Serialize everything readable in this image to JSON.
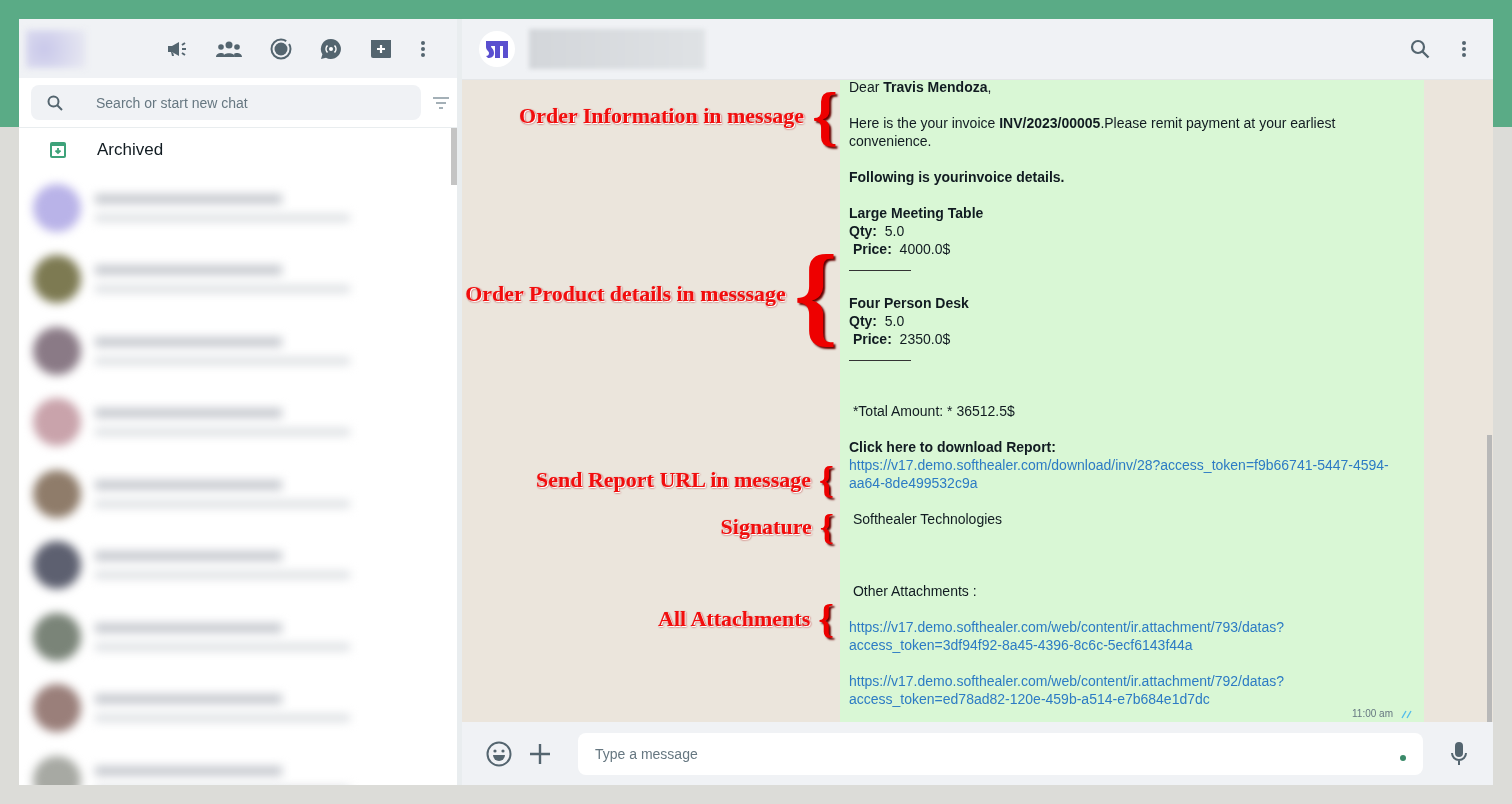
{
  "sidebar": {
    "search": {
      "placeholder": "Search or start new chat"
    },
    "archived": {
      "label": "Archived"
    }
  },
  "message": {
    "lines": [
      {
        "kind": "rich",
        "text": "Dear **Travis Mendoza**,"
      },
      {
        "kind": "blank"
      },
      {
        "kind": "rich",
        "text": "Here is the your invoice **INV/2023/00005**.Please remit payment at your earliest convenience."
      },
      {
        "kind": "blank"
      },
      {
        "kind": "heading",
        "text": "Following is yourinvoice details."
      },
      {
        "kind": "blank"
      },
      {
        "kind": "heading",
        "text": "Large Meeting Table"
      },
      {
        "kind": "rich",
        "text": "**Qty:**  5.0"
      },
      {
        "kind": "rich",
        "text": " **Price:**  4000.0$"
      },
      {
        "kind": "rule"
      },
      {
        "kind": "blank"
      },
      {
        "kind": "heading",
        "text": "Four Person Desk"
      },
      {
        "kind": "rich",
        "text": "**Qty:**  5.0"
      },
      {
        "kind": "rich",
        "text": " **Price:**  2350.0$"
      },
      {
        "kind": "rule"
      },
      {
        "kind": "blank"
      },
      {
        "kind": "blank"
      },
      {
        "kind": "plain",
        "text": " *Total Amount: * 36512.5$"
      },
      {
        "kind": "blank"
      },
      {
        "kind": "link",
        "label": "Click here to download Report:",
        "url": "https://v17.demo.softhealer.com/download/inv/28?access_token=f9b66741-5447-4594-aa64-8de499532c9a"
      },
      {
        "kind": "blank"
      },
      {
        "kind": "plain",
        "text": " Softhealer Technologies"
      },
      {
        "kind": "blank"
      },
      {
        "kind": "blank"
      },
      {
        "kind": "blank"
      },
      {
        "kind": "plain",
        "text": " Other Attachments :"
      },
      {
        "kind": "blank"
      },
      {
        "kind": "link",
        "url": "https://v17.demo.softhealer.com/web/content/ir.attachment/793/datas?access_token=3df94f92-8a45-4396-8c6c-5ecf6143f44a"
      },
      {
        "kind": "blank"
      },
      {
        "kind": "link",
        "url": "https://v17.demo.softhealer.com/web/content/ir.attachment/792/datas?access_token=ed78ad82-120e-459b-a514-e7b684e1d7dc"
      }
    ],
    "time": "11:00 am"
  },
  "annotations": [
    {
      "text": "Order Information in message",
      "brace": "{"
    },
    {
      "text": "Order Product details in messsage",
      "brace": "{"
    },
    {
      "text": "Send Report URL in message",
      "brace": "{"
    },
    {
      "text": "Signature",
      "brace": "{"
    },
    {
      "text": "All Attachments",
      "brace": "{"
    }
  ],
  "composer": {
    "placeholder": "Type a message"
  }
}
